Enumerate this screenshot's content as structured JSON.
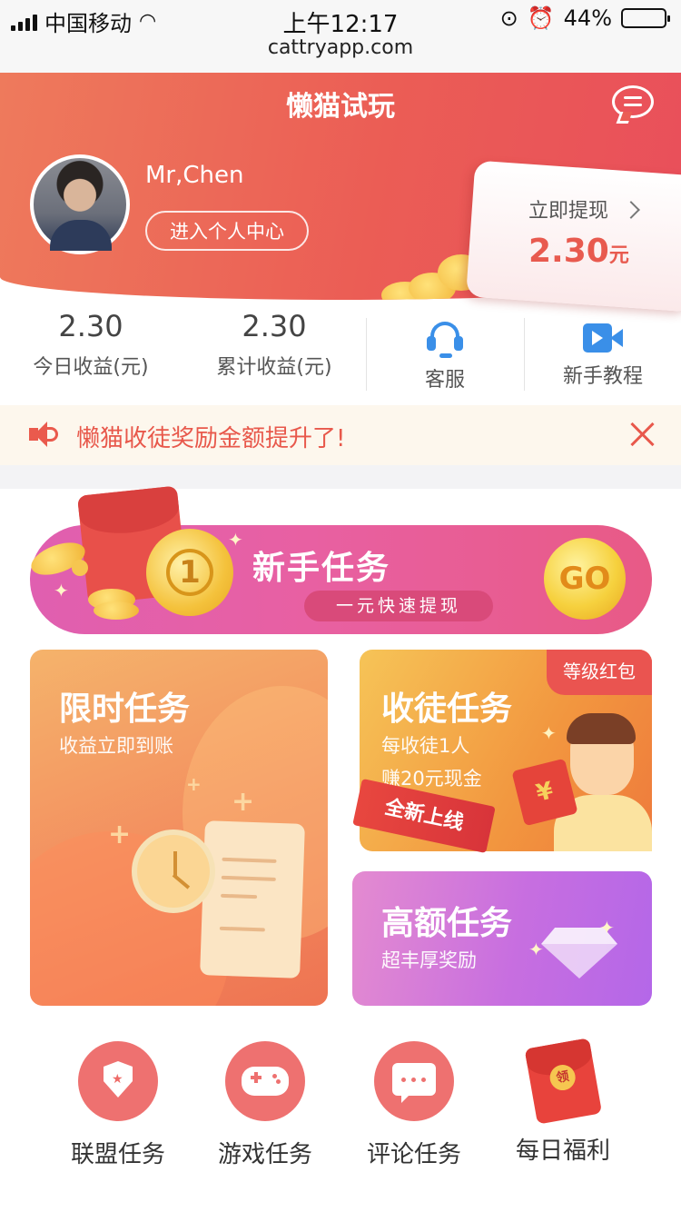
{
  "status_bar": {
    "carrier": "中国移动",
    "time": "上午12:17",
    "url": "cattryapp.com",
    "battery": "44%",
    "battery_level": 0.44
  },
  "header": {
    "title": "懒猫试玩",
    "username": "Mr,Chen",
    "profile_button": "进入个人中心",
    "withdraw_label": "立即提现",
    "withdraw_amount": "2.30",
    "withdraw_unit": "元",
    "accent": "#eb5d55"
  },
  "stats": [
    {
      "value": "2.30",
      "label": "今日收益(元)"
    },
    {
      "value": "2.30",
      "label": "累计收益(元)"
    }
  ],
  "quick_links": [
    {
      "label": "客服",
      "icon": "headset-icon"
    },
    {
      "label": "新手教程",
      "icon": "video-icon"
    }
  ],
  "notice": {
    "text": "懒猫收徒奖励金额提升了!",
    "icon": "speaker-icon"
  },
  "banner": {
    "coin_number": "1",
    "title": "新手任务",
    "subtitle": "一元快速提现",
    "go": "GO"
  },
  "cards": {
    "limited": {
      "title": "限时任务",
      "subtitle": "收益立即到账"
    },
    "recruit": {
      "title": "收徒任务",
      "line1": "每收徒1人",
      "line2": "赚20元现金",
      "tag": "等级红包",
      "ribbon": "全新上线",
      "envelope_symbol": "¥"
    },
    "high": {
      "title": "高额任务",
      "subtitle": "超丰厚奖励"
    }
  },
  "bottom_nav": [
    {
      "label": "联盟任务",
      "icon": "shield-icon"
    },
    {
      "label": "游戏任务",
      "icon": "gamepad-icon"
    },
    {
      "label": "评论任务",
      "icon": "comment-icon"
    },
    {
      "label": "每日福利",
      "icon": "red-envelope-icon",
      "badge": "领"
    }
  ]
}
